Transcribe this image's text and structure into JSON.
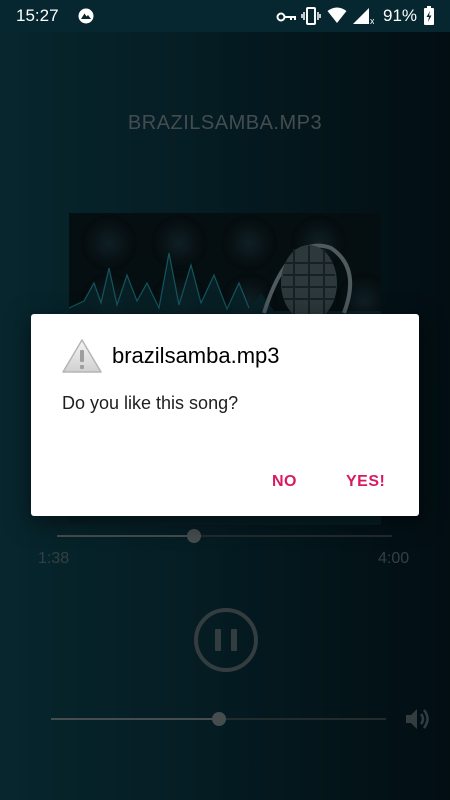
{
  "status_bar": {
    "time": "15:27",
    "battery_percent": "91%"
  },
  "player": {
    "track_title": "BRAZILSAMBA.MP3",
    "elapsed": "1:38",
    "duration": "4:00",
    "seek_fraction": 0.408,
    "volume_fraction": 0.5
  },
  "dialog": {
    "title": "brazilsamba.mp3",
    "message": "Do you like this song?",
    "no_label": "NO",
    "yes_label": "YES!",
    "icon": "warning-icon"
  },
  "colors": {
    "accent": "#d81b60",
    "background": "#0a3440"
  }
}
